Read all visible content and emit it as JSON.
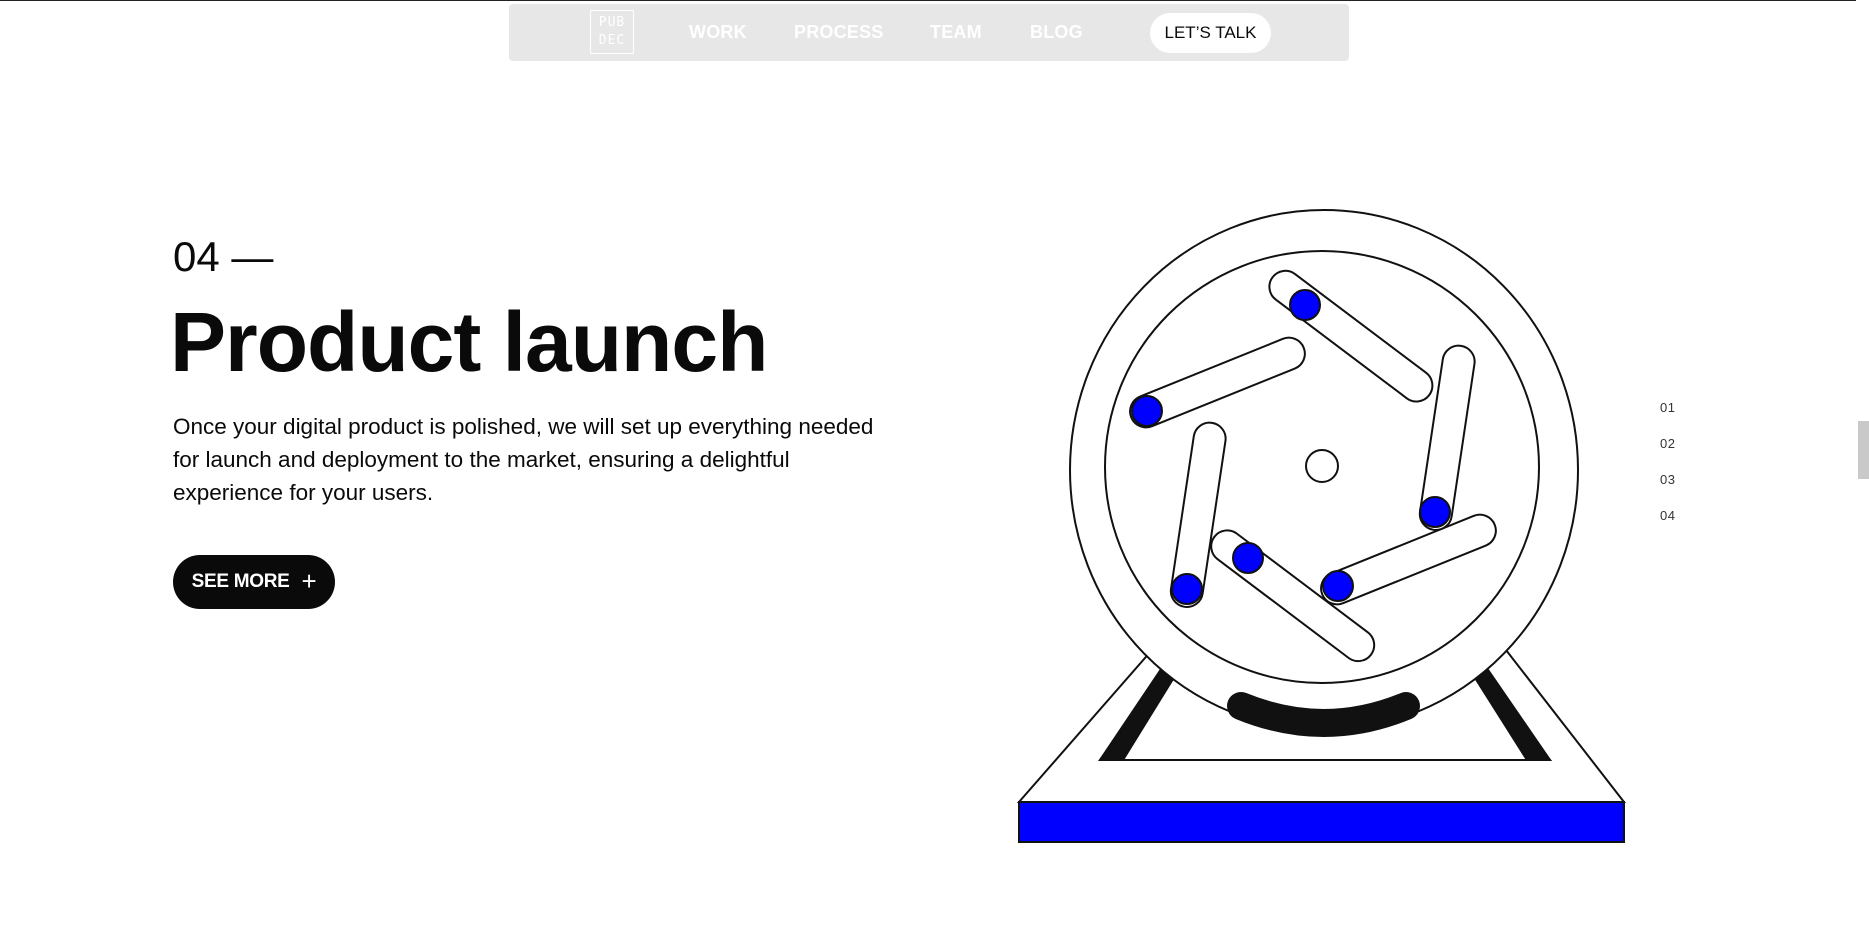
{
  "nav": {
    "logo_top": "PUB",
    "logo_bottom": "DEC",
    "links": [
      "WORK",
      "PROCESS",
      "TEAM",
      "BLOG"
    ],
    "cta": "LET’S TALK"
  },
  "hero": {
    "step": "04 —",
    "title": "Product launch",
    "description": "Once your digital product is polished, we will set up everything needed for launch and deployment to the market, ensuring a delightful experience for your users.",
    "button_label": "SEE MORE",
    "button_icon": "+"
  },
  "pager": [
    "01",
    "02",
    "03",
    "04"
  ],
  "colors": {
    "accent": "#0000ff",
    "ink": "#0a0a0a",
    "nav_bg": "#e7e7e7"
  }
}
